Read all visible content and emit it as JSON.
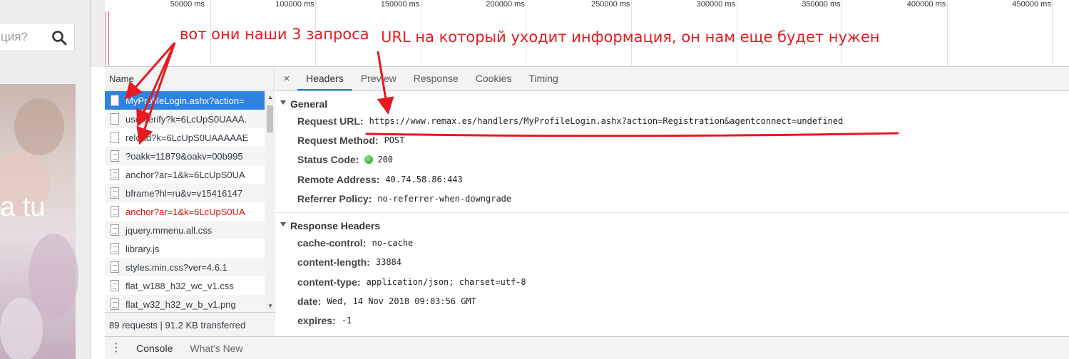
{
  "site": {
    "search_text": "ция?",
    "hero_text": "a tu"
  },
  "timeline": {
    "ticks": [
      "50000 ms",
      "100000 ms",
      "150000 ms",
      "200000 ms",
      "250000 ms",
      "300000 ms",
      "350000 ms",
      "400000 ms",
      "450000 ms"
    ]
  },
  "request_list": {
    "header": "Name",
    "rows": [
      {
        "name": "MyProfileLogin.ashx?action=",
        "state": "selected"
      },
      {
        "name": "userverify?k=6LcUpS0UAAA.",
        "state": "normal"
      },
      {
        "name": "reload?k=6LcUpS0UAAAAAE",
        "state": "normal"
      },
      {
        "name": "?oakk=11879&oakv=00b995",
        "state": "normal"
      },
      {
        "name": "anchor?ar=1&k=6LcUpS0UA",
        "state": "normal"
      },
      {
        "name": "bframe?hl=ru&v=v15416147",
        "state": "normal"
      },
      {
        "name": "anchor?ar=1&k=6LcUpS0UA",
        "state": "error"
      },
      {
        "name": "jquery.mmenu.all.css",
        "state": "normal"
      },
      {
        "name": "library.js",
        "state": "normal"
      },
      {
        "name": "styles.min.css?ver=4.6.1",
        "state": "normal"
      },
      {
        "name": "flat_w188_h32_wc_v1.css",
        "state": "normal"
      },
      {
        "name": "flat_w32_h32_w_b_v1.png",
        "state": "normal"
      }
    ],
    "footer": "89 requests  |  91.2 KB transferred"
  },
  "details": {
    "close_glyph": "×",
    "tabs": [
      "Headers",
      "Preview",
      "Response",
      "Cookies",
      "Timing"
    ],
    "active_tab": "Headers",
    "general": {
      "title": "General",
      "items": [
        {
          "key": "Request URL:",
          "value": "https://www.remax.es/handlers/MyProfileLogin.ashx?action=Registration&agentconnect=undefined"
        },
        {
          "key": "Request Method:",
          "value": "POST"
        },
        {
          "key": "Status Code:",
          "value": "200",
          "status_color": "#2bb52b"
        },
        {
          "key": "Remote Address:",
          "value": "40.74.58.86:443"
        },
        {
          "key": "Referrer Policy:",
          "value": "no-referrer-when-downgrade"
        }
      ]
    },
    "response_headers": {
      "title": "Response Headers",
      "items": [
        {
          "key": "cache-control:",
          "value": "no-cache"
        },
        {
          "key": "content-length:",
          "value": "33884"
        },
        {
          "key": "content-type:",
          "value": "application/json; charset=utf-8"
        },
        {
          "key": "date:",
          "value": "Wed, 14 Nov 2018 09:03:56 GMT"
        },
        {
          "key": "expires:",
          "value": "-1"
        }
      ]
    }
  },
  "drawer": {
    "tabs": [
      "Console",
      "What's New"
    ]
  },
  "annotations": {
    "requests_note": "вот они наши 3 запроса",
    "url_note": "URL на который уходит информация, он нам еще будет нужен",
    "color": "#e8191f"
  }
}
